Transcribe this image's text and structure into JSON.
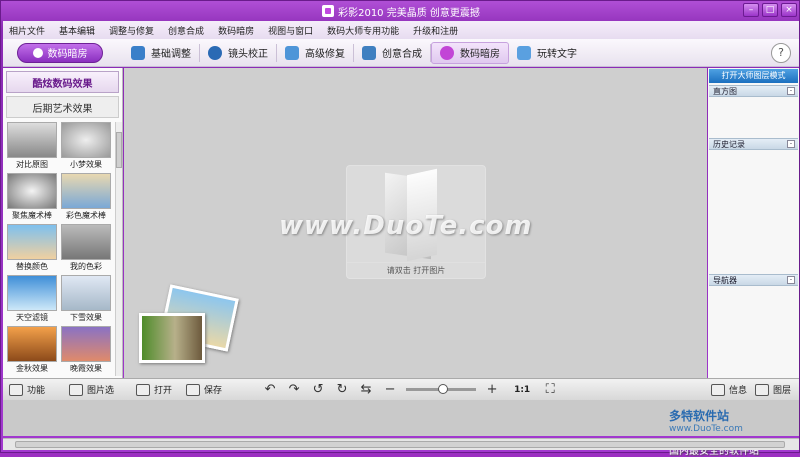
{
  "titlebar": {
    "title": "彩影2010 完美晶质 创意更震撼"
  },
  "menubar": {
    "items": [
      "相片文件",
      "基本编辑",
      "调整与修复",
      "创意合成",
      "数码暗房",
      "视图与窗口",
      "数码大师专用功能",
      "升级和注册"
    ]
  },
  "toolbar": {
    "main": "数码暗房",
    "tools": [
      "基础调整",
      "镜头校正",
      "高级修复",
      "创意合成",
      "数码暗房",
      "玩转文字"
    ],
    "help": "?"
  },
  "leftpanel": {
    "tab_active": "酷炫数码效果",
    "tab_other": "后期艺术效果",
    "thumbs": [
      "对比原图",
      "小梦效果",
      "聚焦魔术棒",
      "彩色魔术棒",
      "替换颜色",
      "我的色彩",
      "天空滤镜",
      "下雪效果",
      "金秋效果",
      "晚霞效果"
    ]
  },
  "canvas": {
    "open_hint": "请双击 打开图片"
  },
  "rightpanel": {
    "top_button": "打开大师图层模式",
    "sections": [
      "直方图",
      "历史记录",
      "导航器"
    ]
  },
  "bottombar": {
    "func": "功能",
    "photos": "图片选",
    "open": "打开",
    "save": "保存",
    "ratio": "1:1",
    "tips": "信息",
    "layer": "图层"
  },
  "watermark": {
    "text": "www.DuoTe.com",
    "site": "www.DuoTe.com",
    "brand": "多特软件站",
    "slogan": "国内最安全的软件站"
  },
  "colors": {
    "accent": "#9c2fc2",
    "panel_blue": "#1b6fbf"
  }
}
